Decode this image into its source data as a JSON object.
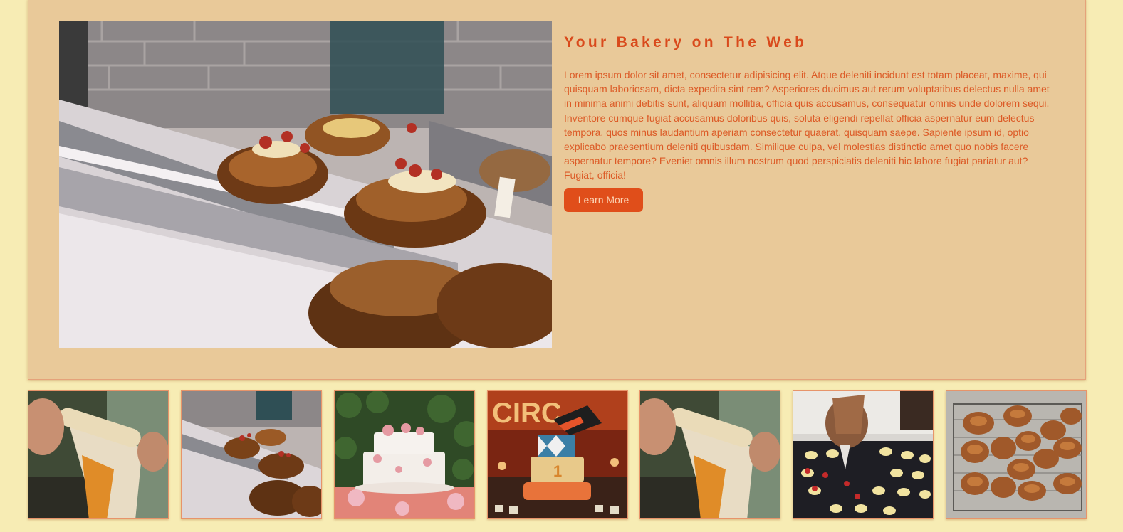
{
  "hero": {
    "title": "Your Bakery on The Web",
    "body": "Lorem ipsum dolor sit amet, consectetur adipisicing elit. Atque deleniti incidunt est totam placeat, maxime, qui quisquam laboriosam, dicta expedita sint rem? Asperiores ducimus aut rerum voluptatibus delectus nulla amet in minima animi debitis sunt, aliquam mollitia, officia quis accusamus, consequatur omnis unde dolorem sequi. Inventore cumque fugiat accusamus doloribus quis, soluta eligendi repellat officia aspernatur eum delectus tempora, quos minus laudantium aperiam consectetur quaerat, quisquam saepe. Sapiente ipsum id, optio explicabo praesentium deleniti quibusdam. Similique culpa, vel molestias distinctio amet quo nobis facere aspernatur tempore? Eveniet omnis illum nostrum quod perspiciatis deleniti hic labore fugiat pariatur aut? Fugiat, officia!",
    "button_label": "Learn More",
    "photo": "croissants-on-display-trays"
  },
  "gallery": [
    {
      "photo": "rolling-pin-dough"
    },
    {
      "photo": "croissants-on-display-trays"
    },
    {
      "photo": "white-floral-tiered-cake"
    },
    {
      "photo": "circus-themed-birthday-cake",
      "sign_text": "CIRC",
      "cake_number": "1"
    },
    {
      "photo": "rolling-pin-dough"
    },
    {
      "photo": "piping-cream-pastries"
    },
    {
      "photo": "croissants-on-cooling-rack"
    }
  ],
  "colors": {
    "page_background": "#f7ecb4",
    "hero_panel": "#e9c999",
    "accent": "#d94a1c",
    "button": "#e04e1a"
  }
}
